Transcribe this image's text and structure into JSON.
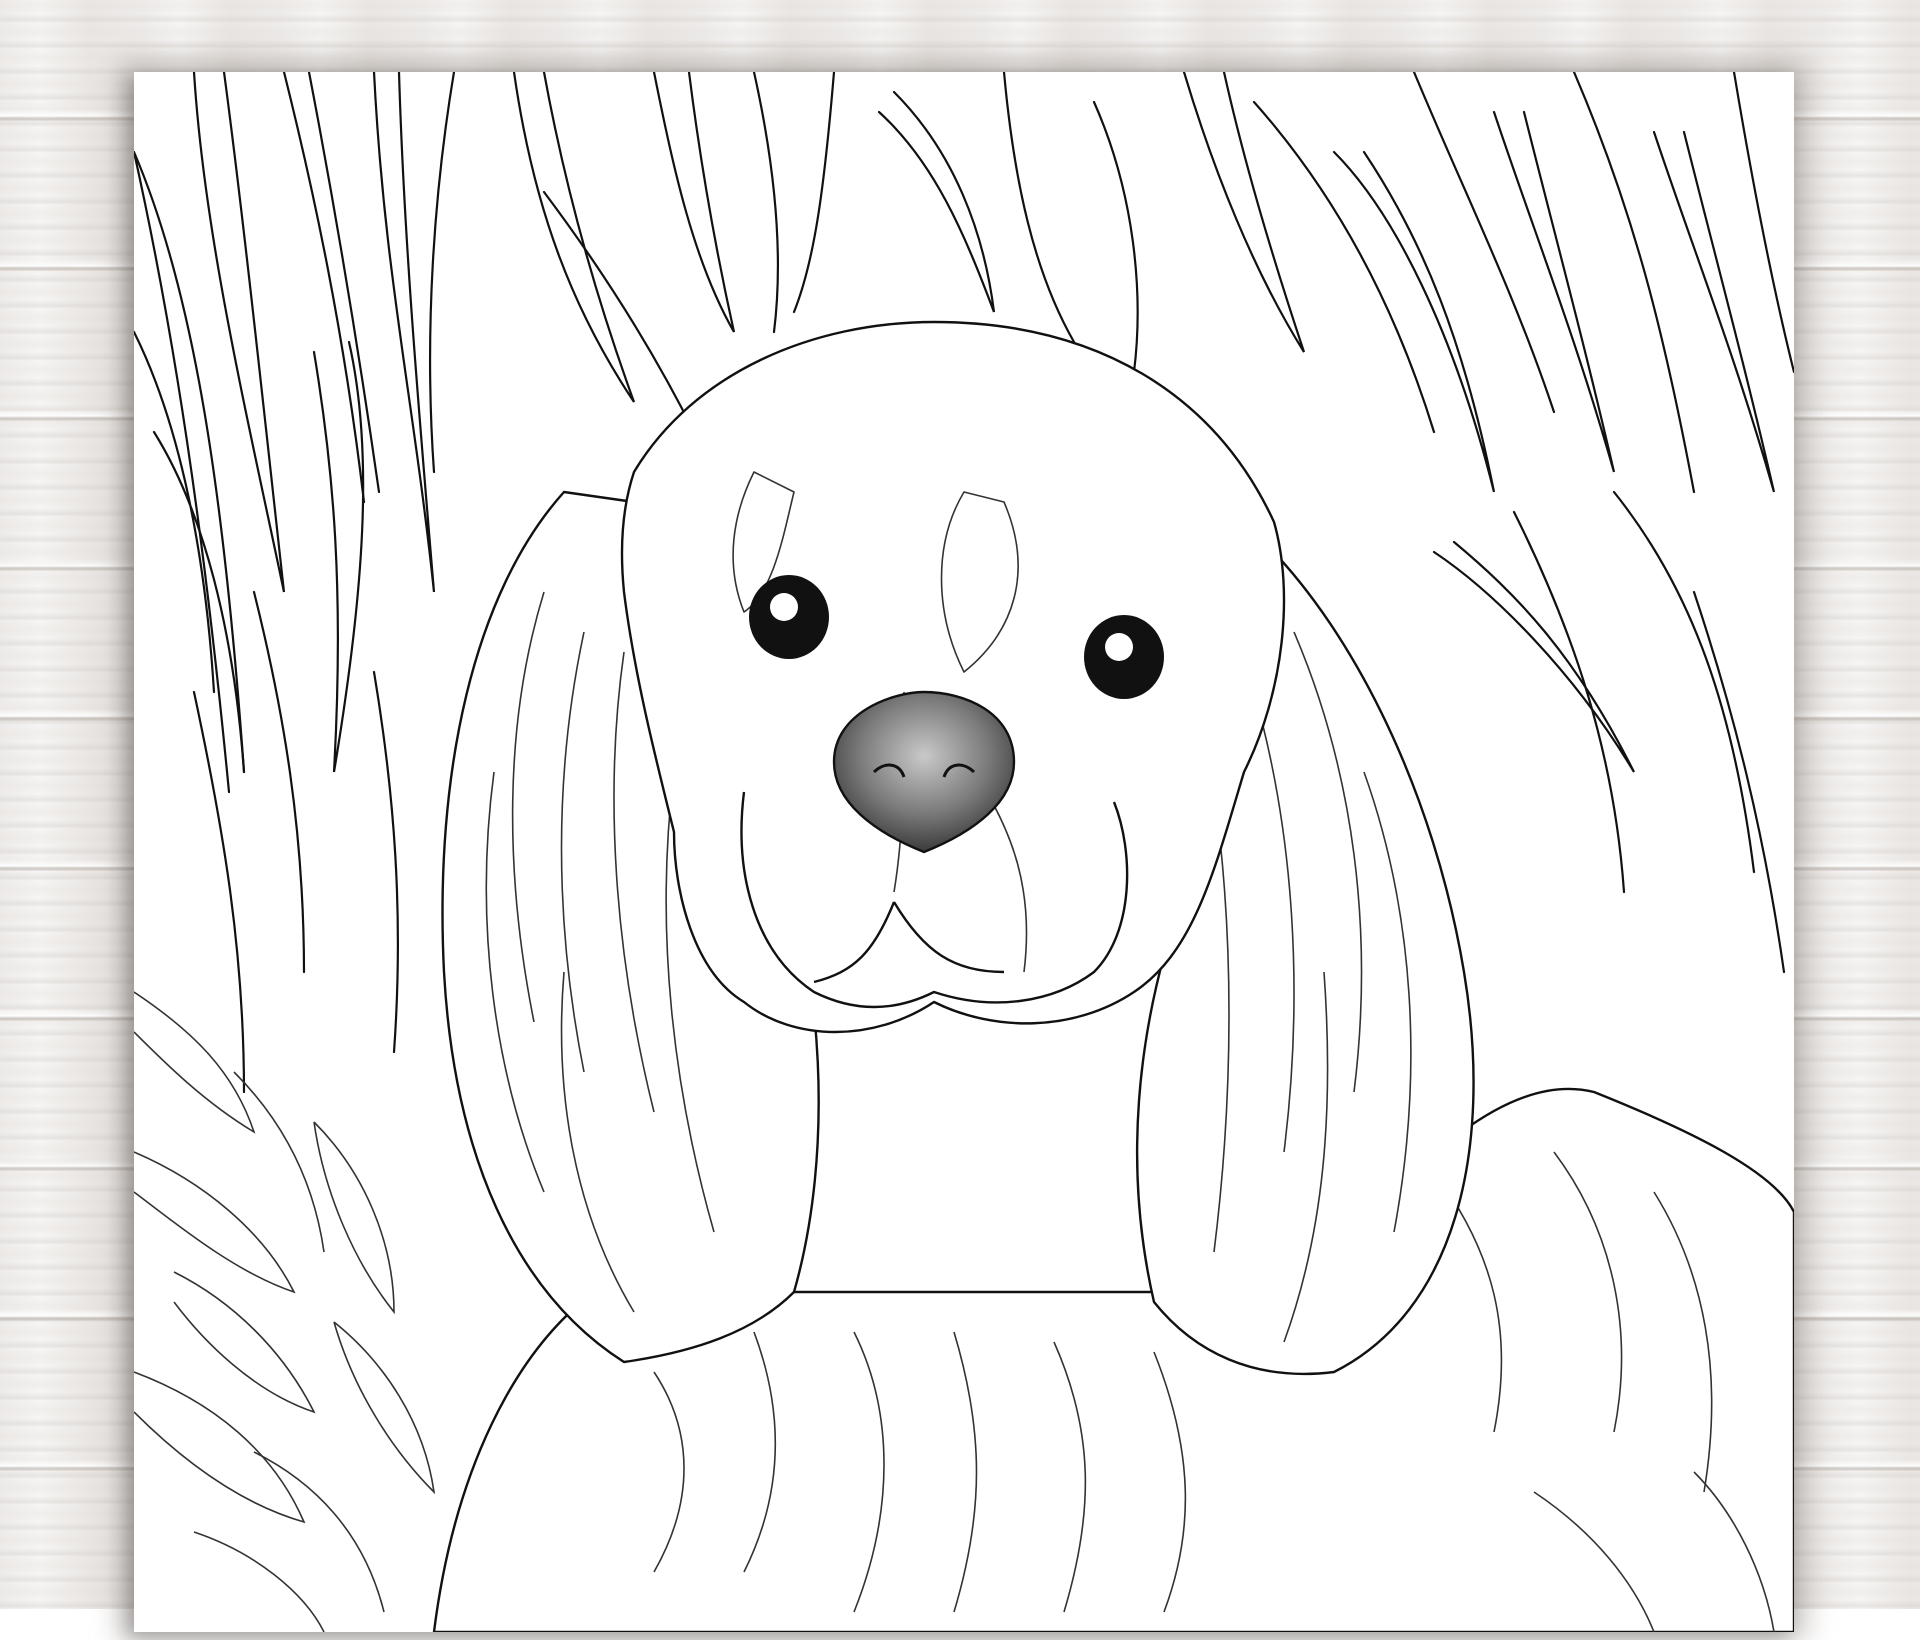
{
  "scene": {
    "background": "whitewashed-wood",
    "artwork": "coloring-page-spaniel-in-grass",
    "colors": {
      "wood": "#eeeceb",
      "paper": "#ffffff",
      "ink": "#111111",
      "nose": "#7a7a7a"
    }
  }
}
